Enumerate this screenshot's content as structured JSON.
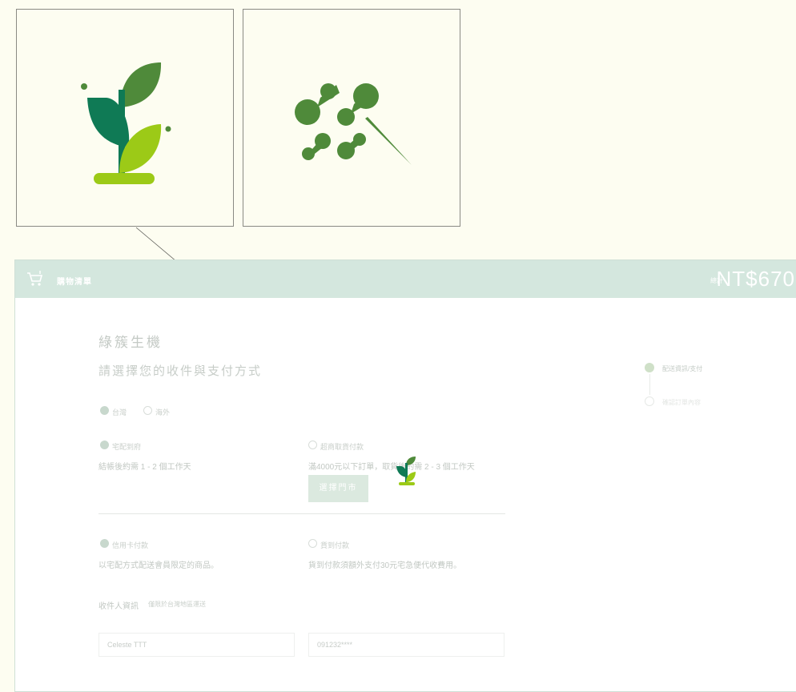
{
  "zoom": {
    "left_icon": "sprout-icon",
    "right_icon": "sparkle-wand-icon"
  },
  "app": {
    "header": {
      "cart_icon": "cart-icon",
      "title": "購物清單",
      "total_label": "總計",
      "total_amount": "NT$670"
    },
    "page_title": "綠簇生機",
    "page_subtitle": "請選擇您的收件與支付方式",
    "region": {
      "options": [
        "台灣",
        "海外"
      ],
      "selected": "台灣"
    },
    "shipping": {
      "options": [
        {
          "label": "宅配到府",
          "desc": "結帳後約需 1 - 2 個工作天",
          "selected": true
        },
        {
          "label": "超商取貨付款",
          "desc": "滿4000元以下訂單，取貨後約需 2 - 3 個工作天",
          "selected": false
        }
      ],
      "store_button": "選擇門市"
    },
    "payment": {
      "options": [
        {
          "label": "信用卡付款",
          "desc": "以宅配方式配送會員限定的商品。",
          "selected": true
        },
        {
          "label": "貨到付款",
          "desc": "貨到付款須額外支付30元宅急便代收費用。",
          "selected": false
        }
      ]
    },
    "recipient": {
      "label": "收件人資訊",
      "note": "僅限於台灣地區運送",
      "name_value": "Celeste TTT",
      "phone_value": "091232****"
    },
    "steps": [
      {
        "label": "配送資訊/支付",
        "active": true
      },
      {
        "label": "確認訂單內容",
        "active": false
      }
    ],
    "colors": {
      "accent_dark_green": "#4f8a3a",
      "accent_teal_green": "#0f7a55",
      "accent_lime": "#9cca17",
      "header_bg": "#d4e7de"
    }
  }
}
